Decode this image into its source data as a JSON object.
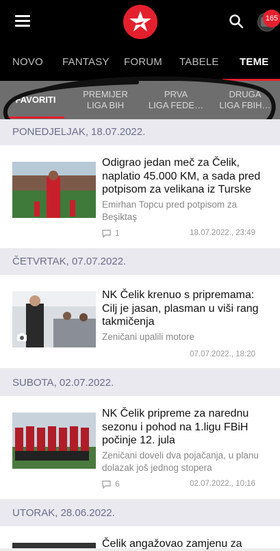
{
  "header": {
    "notification_count": "165",
    "icons": {
      "menu": "hamburger-menu-icon",
      "search": "search-icon",
      "logo": "star-logo",
      "avatar": "user-avatar"
    }
  },
  "nav": {
    "tabs": [
      "NOVO",
      "FANTASY",
      "FORUM",
      "TABELE",
      "TEME"
    ],
    "active": "TEME"
  },
  "subnav": {
    "tabs": [
      "FAVORITI",
      "PREMIJER\nLIGA BIH",
      "PRVA\nLIGA FEDE…",
      "DRUGA\nLIGA FBIH…"
    ],
    "active": "FAVORITI"
  },
  "colors": {
    "accent": "#e5202e",
    "date_text": "#6e6c8c"
  },
  "feed": [
    {
      "date": "PONEDJELJAK, 18.07.2022.",
      "headline": "Odigrao jedan meč za Čelik, naplatio 45.000 KM, a sada pred potpisom za velikana iz Turske",
      "lede": "Emirhan Topcu pred potpisom za Beşiktaş",
      "comments": "1",
      "timestamp": "18.07.2022., 23:49"
    },
    {
      "date": "ČETVRTAK, 07.07.2022.",
      "headline": "NK Čelik krenuo s pripremama: Cilj je jasan, plasman u viši rang takmičenja",
      "lede": "Zeničani upalili motore",
      "comments": "",
      "timestamp": "07.07.2022., 18:20",
      "has_photo_icon": true
    },
    {
      "date": "SUBOTA, 02.07.2022.",
      "headline": "NK Čelik pripreme za narednu sezonu i pohod na 1.ligu FBiH počinje 12. jula",
      "lede": "Zeničani doveli dva pojačanja, u planu dolazak još jednog stopera",
      "comments": "6",
      "timestamp": "02.07.2022., 10:16"
    },
    {
      "date": "UTORAK, 28.06.2022.",
      "headline": "Čelik angažovao zamjenu za"
    }
  ]
}
